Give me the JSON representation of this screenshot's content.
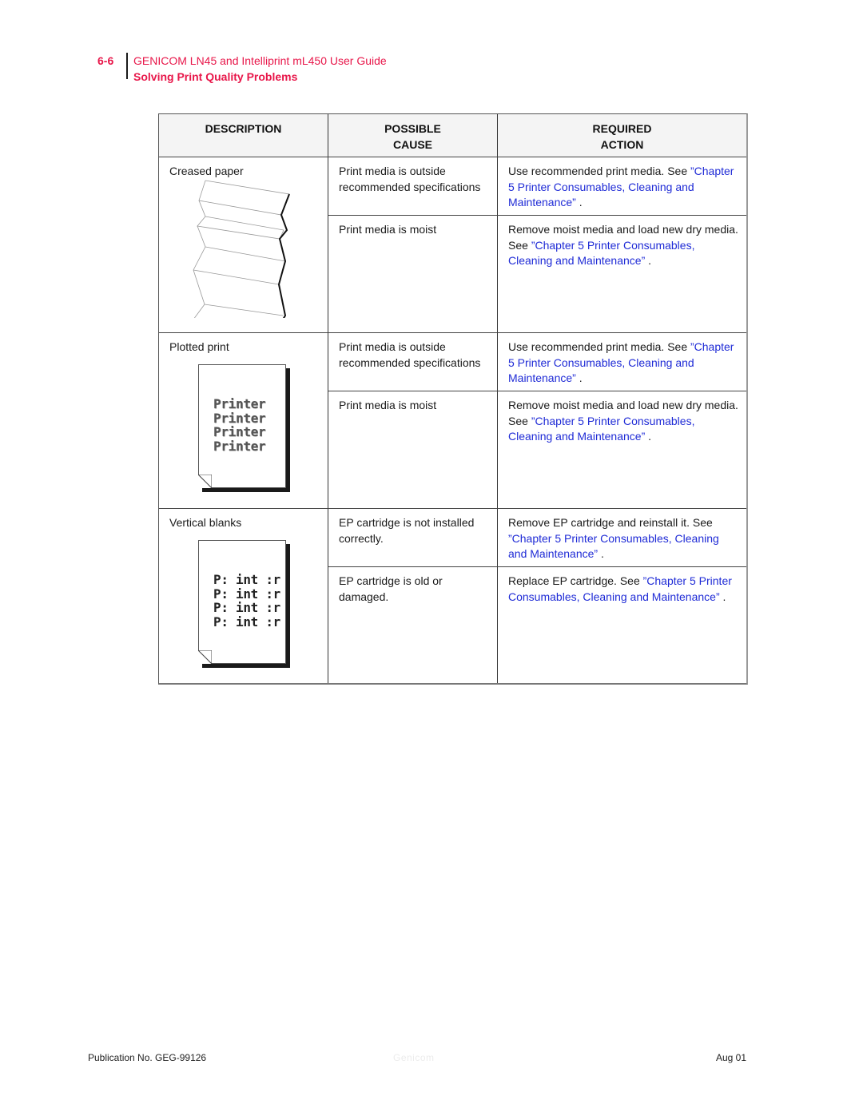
{
  "header": {
    "page_number": "6-6",
    "guide_title": "GENICOM LN45 and Intelliprint mL450 User Guide",
    "section_title": "Solving Print Quality Problems",
    "accent_color": "#e8174a"
  },
  "table": {
    "columns": [
      {
        "line1": "DESCRIPTION",
        "line2": ""
      },
      {
        "line1": "POSSIBLE",
        "line2": "CAUSE"
      },
      {
        "line1": "REQUIRED",
        "line2": "ACTION"
      }
    ],
    "link_color": "#1f2bd6",
    "groups": [
      {
        "description": "Creased paper",
        "illustration": "creased-paper-icon",
        "rows": [
          {
            "cause": "Print media is outside recommended specifications",
            "action_text": "Use recommended print media. See ",
            "action_link": "”Chapter 5 Printer Consumables, Cleaning and Maintenance”",
            "action_suffix": " ."
          },
          {
            "cause": "Print media is moist",
            "action_text": "Remove moist media and load new dry media. See ",
            "action_link": "”Chapter 5 Printer Consumables, Cleaning and Maintenance”",
            "action_suffix": " ."
          }
        ]
      },
      {
        "description": "Plotted print",
        "illustration": "plotted-print-icon",
        "sample_lines": [
          "Printer",
          "Printer",
          "Printer",
          "Printer"
        ],
        "rows": [
          {
            "cause": "Print media is outside recommended specifications",
            "action_text": "Use recommended print media. See ",
            "action_link": "”Chapter 5 Printer Consumables, Cleaning and Maintenance”",
            "action_suffix": " ."
          },
          {
            "cause": "Print media is moist",
            "action_text": "Remove moist media and load new dry media. See ",
            "action_link": "”Chapter 5 Printer Consumables, Cleaning and Maintenance”",
            "action_suffix": " ."
          }
        ]
      },
      {
        "description": "Vertical blanks",
        "illustration": "vertical-blanks-icon",
        "sample_lines": [
          "P: int :r",
          "P: int :r",
          "P: int :r",
          "P: int :r"
        ],
        "rows": [
          {
            "cause": "EP cartridge is not installed correctly.",
            "action_text": "Remove EP cartridge and reinstall it. See ",
            "action_link": "”Chapter 5 Printer Consumables, Cleaning and Maintenance”",
            "action_suffix": " ."
          },
          {
            "cause": "EP cartridge is old or damaged.",
            "action_text": "Replace EP cartridge. See ",
            "action_link": "”Chapter 5 Printer Consumables, Cleaning and Maintenance”",
            "action_suffix": " ."
          }
        ]
      }
    ]
  },
  "footer": {
    "publication": "Publication No. GEG-99126",
    "watermark": "Genicom",
    "date": "Aug 01"
  }
}
